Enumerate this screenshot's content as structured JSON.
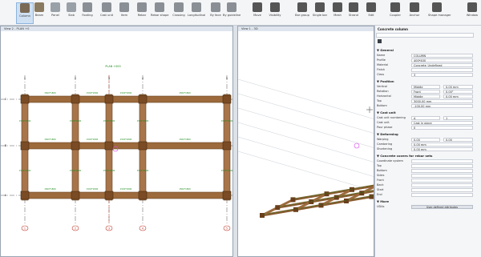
{
  "ribbon": {
    "buttons": [
      {
        "label": "Column",
        "icon": "column-icon",
        "color": "#7a6a55",
        "active": true
      },
      {
        "label": "Beam",
        "icon": "beam-icon",
        "color": "#8a7a60"
      },
      {
        "label": "Panel",
        "icon": "panel-icon",
        "color": "#9aa0a8"
      },
      {
        "label": "Slab",
        "icon": "slab-icon",
        "color": "#9aa0a8"
      },
      {
        "label": "Footing",
        "icon": "footing-icon",
        "color": "#8a8f96"
      },
      {
        "label": "Cast unit",
        "icon": "cast-unit-icon",
        "color": "#8a8f96"
      },
      {
        "label": "Item",
        "icon": "item-icon",
        "color": "#8a8f96"
      },
      {
        "label": "Rebar",
        "icon": "rebar-icon",
        "color": "#8a8f96"
      },
      {
        "label": "Rebar shape",
        "icon": "rebar-shape-icon",
        "color": "#8a8f96"
      },
      {
        "label": "Crossing",
        "icon": "crossing-icon",
        "color": "#8a8f96"
      },
      {
        "label": "Longitudinal",
        "icon": "longitudinal-icon",
        "color": "#8a8f96"
      },
      {
        "label": "By face",
        "icon": "by-face-icon",
        "color": "#8a8f96"
      },
      {
        "label": "By guideline",
        "icon": "by-guideline-icon",
        "color": "#8a8f96"
      },
      {
        "label": "Move",
        "icon": "move-icon",
        "color": "#555"
      },
      {
        "label": "Visibility",
        "icon": "visibility-icon",
        "color": "#555"
      },
      {
        "label": "Bar group",
        "icon": "bar-group-icon",
        "color": "#555"
      },
      {
        "label": "Single bar",
        "icon": "single-bar-icon",
        "color": "#555"
      },
      {
        "label": "Mesh",
        "icon": "mesh-icon",
        "color": "#555"
      },
      {
        "label": "Strand",
        "icon": "strand-icon",
        "color": "#555"
      },
      {
        "label": "Edit",
        "icon": "edit-icon",
        "color": "#555"
      },
      {
        "label": "Coupler",
        "icon": "coupler-icon",
        "color": "#555"
      },
      {
        "label": "Anchor",
        "icon": "anchor-icon",
        "color": "#555"
      },
      {
        "label": "Shape manager",
        "icon": "shape-manager-icon",
        "color": "#555"
      },
      {
        "label": "Window",
        "icon": "window-icon",
        "color": "#555"
      }
    ]
  },
  "views": {
    "plan": {
      "title": "View 2 - PLAN +0",
      "plan_label": "PLAN +000"
    },
    "view3d": {
      "title": "View 1 - 3D"
    }
  },
  "grid": {
    "cols": [
      "1",
      "2",
      "3",
      "4",
      "5"
    ],
    "rows": [
      "C",
      "B",
      "A"
    ],
    "dims": [
      "1500*1800",
      "1500*1800"
    ]
  },
  "panel": {
    "title": "Concrete column",
    "sections": {
      "general": "General",
      "position": "Position",
      "cast_unit": "Cast unit",
      "deforming": "Deforming",
      "covers": "Concrete covers for rebar sets",
      "more": "More"
    },
    "general": [
      {
        "label": "Name",
        "value": "COLUMN"
      },
      {
        "label": "Profile",
        "value": "400*400"
      },
      {
        "label": "Material",
        "value": "Concrete_Undefined"
      },
      {
        "label": "Finish",
        "value": ""
      },
      {
        "label": "Class",
        "value": "3"
      }
    ],
    "position": [
      {
        "label": "Vertical",
        "value": "Middle",
        "extra": "0.00 mm"
      },
      {
        "label": "Rotation",
        "value": "Front",
        "extra": "0.00°"
      },
      {
        "label": "Horizontal",
        "value": "Middle",
        "extra": "0.00 mm"
      },
      {
        "label": "Top",
        "value": "3000.00 mm"
      },
      {
        "label": "Bottom",
        "value": "-100.00 mm"
      }
    ],
    "cast_unit": [
      {
        "label": "Cast unit numbering",
        "value": "A",
        "extra": "1"
      },
      {
        "label": "Cast unit",
        "value": "Cast in place"
      },
      {
        "label": "Pour phase",
        "value": "0"
      }
    ],
    "deforming": [
      {
        "label": "Warping",
        "value": "0.00",
        "extra": "0.00"
      },
      {
        "label": "Cambering",
        "value": "0.00 mm"
      },
      {
        "label": "Shortening",
        "value": "0.00 mm"
      }
    ],
    "covers": [
      {
        "label": "Coordinate system",
        "value": ""
      },
      {
        "label": "Top",
        "value": ""
      },
      {
        "label": "Bottom",
        "value": ""
      },
      {
        "label": "Sides",
        "value": ""
      },
      {
        "label": "Front",
        "value": ""
      },
      {
        "label": "Back",
        "value": ""
      },
      {
        "label": "Start",
        "value": ""
      },
      {
        "label": "End",
        "value": ""
      }
    ],
    "more": {
      "label": "UDAs",
      "button": "User-defined attributes"
    }
  }
}
